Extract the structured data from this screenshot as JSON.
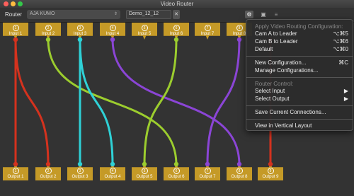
{
  "window": {
    "title": "Video Router"
  },
  "toolbar": {
    "router_label": "Router",
    "router_value": "AJA KUMO",
    "config_value": "Demo_12_12",
    "clear_glyph": "✕",
    "icons": [
      "gear-icon",
      "layout-icon",
      "list-icon"
    ]
  },
  "inputs": [
    "Input 1",
    "Input 2",
    "Input 3",
    "Input 4",
    "Input 5",
    "Input 6",
    "Input 7",
    "Input 8"
  ],
  "outputs": [
    "Output 1",
    "Output 2",
    "Output 3",
    "Output 4",
    "Output 5",
    "Output 6",
    "Output 7",
    "Output 8",
    "Output 9"
  ],
  "numbers": [
    "1",
    "2",
    "3",
    "4",
    "5",
    "6",
    "7",
    "8",
    "9"
  ],
  "connections": [
    {
      "input": 1,
      "output": 1,
      "color": "#d4321e"
    },
    {
      "input": 1,
      "output": 2,
      "color": "#d4321e"
    },
    {
      "input": 2,
      "output": 6,
      "color": "#9ccd2e"
    },
    {
      "input": 3,
      "output": 3,
      "color": "#2fd1d6"
    },
    {
      "input": 3,
      "output": 4,
      "color": "#2fd1d6"
    },
    {
      "input": 4,
      "output": 8,
      "color": "#8b45d6"
    },
    {
      "input": 6,
      "output": 5,
      "color": "#9ccd2e"
    },
    {
      "input": 8,
      "output": 7,
      "color": "#8b45d6"
    },
    {
      "input": 9,
      "output": 9,
      "color": "#d4321e"
    }
  ],
  "menu": {
    "header_apply": "Apply Video Routing Configuration:",
    "cam_a": "Cam A to Leader",
    "cam_a_key": "⌥⌘5",
    "cam_b": "Cam B to Leader",
    "cam_b_key": "⌥⌘6",
    "default": "Default",
    "default_key": "⌥⌘0",
    "new_config": "New Configuration...",
    "new_config_key": "⌘C",
    "manage": "Manage Configurations...",
    "header_router": "Router Control:",
    "select_input": "Select Input",
    "select_output": "Select Output",
    "submenu_arrow": "▶",
    "save": "Save Current Connections...",
    "vertical": "View in Vertical Layout"
  },
  "colors": {
    "tag": "#c59a27",
    "red": "#d4321e",
    "green": "#9ccd2e",
    "cyan": "#2fd1d6",
    "purple": "#8b45d6"
  }
}
